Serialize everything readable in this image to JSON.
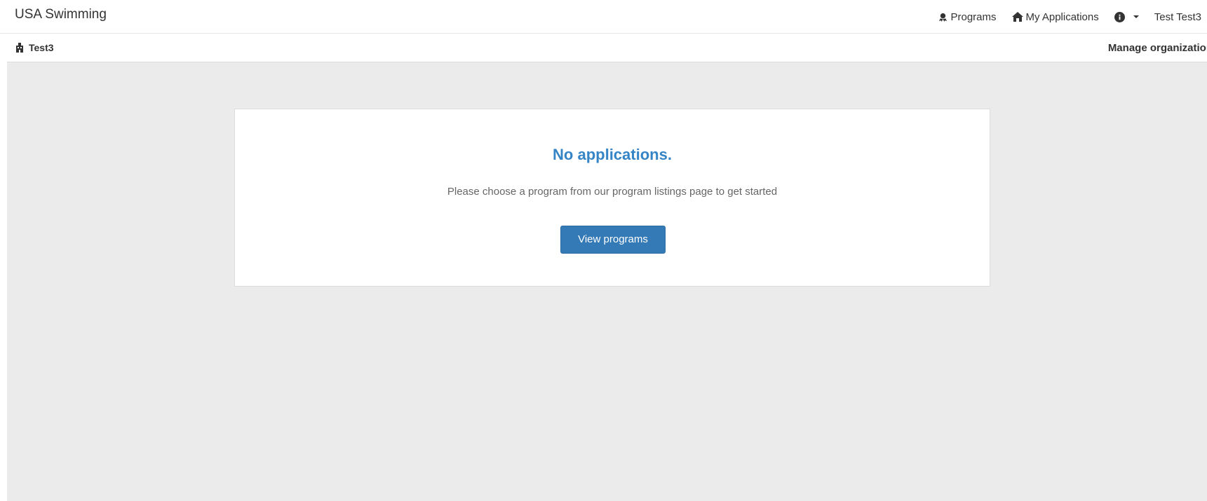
{
  "header": {
    "brand": "USA Swimming",
    "nav": [
      {
        "label": "Programs",
        "icon": "award-icon"
      },
      {
        "label": "My Applications",
        "icon": "home-icon"
      }
    ],
    "help_icon": "info-icon",
    "user_label": "Test Test3"
  },
  "subheader": {
    "org_name": "Test3",
    "org_icon": "building-icon",
    "manage_label": "Manage organization"
  },
  "card": {
    "title": "No applications.",
    "message": "Please choose a program from our program listings page to get started",
    "button_label": "View programs"
  },
  "colors": {
    "accent": "#337ab7",
    "title": "#3585c6",
    "background": "#ebebeb"
  }
}
